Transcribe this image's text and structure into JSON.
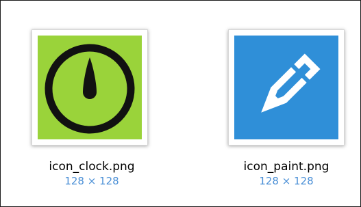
{
  "colors": {
    "clock_bg": "#9ad33a",
    "clock_fg": "#111111",
    "paint_bg": "#2f8fd8",
    "paint_fg": "#ffffff",
    "dims_text": "#4a8fd6"
  },
  "files": [
    {
      "name": "icon_clock.png",
      "dimensions": "128 × 128",
      "icon": "clock-icon"
    },
    {
      "name": "icon_paint.png",
      "dimensions": "128 × 128",
      "icon": "paint-pencil-icon"
    }
  ]
}
